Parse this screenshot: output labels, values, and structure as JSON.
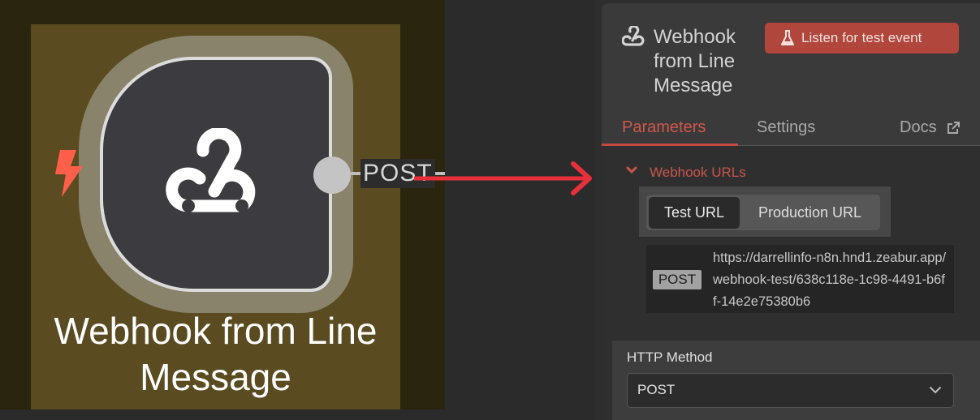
{
  "canvas": {
    "node": {
      "title": "Webhook from Line\nMessage",
      "output_label": "POST",
      "icons": {
        "node": "webhook-icon",
        "trigger": "lightning-bolt-icon",
        "arrow": "red-arrow-icon"
      }
    },
    "colors": {
      "highlight": "#5a4c20",
      "arrow": "#e8303a",
      "trigger": "#ff5f4a"
    }
  },
  "panel": {
    "title": "Webhook\nfrom Line\nMessage",
    "listen_button": "Listen for test event",
    "tabs": {
      "parameters": "Parameters",
      "settings": "Settings",
      "docs": "Docs"
    },
    "webhook_urls": {
      "section_title": "Webhook URLs",
      "toggle": {
        "test": "Test URL",
        "production": "Production URL",
        "selected": "Test URL"
      },
      "method_badge": "POST",
      "url": "https://darrellinfo-n8n.hnd1.zeabur.app/webhook-test/638c118e-1c98-4491-b6ff-14e2e75380b6"
    },
    "http_method": {
      "label": "HTTP Method",
      "value": "POST"
    },
    "colors": {
      "accent": "#c9554b",
      "listen_button": "#b0463c"
    }
  }
}
